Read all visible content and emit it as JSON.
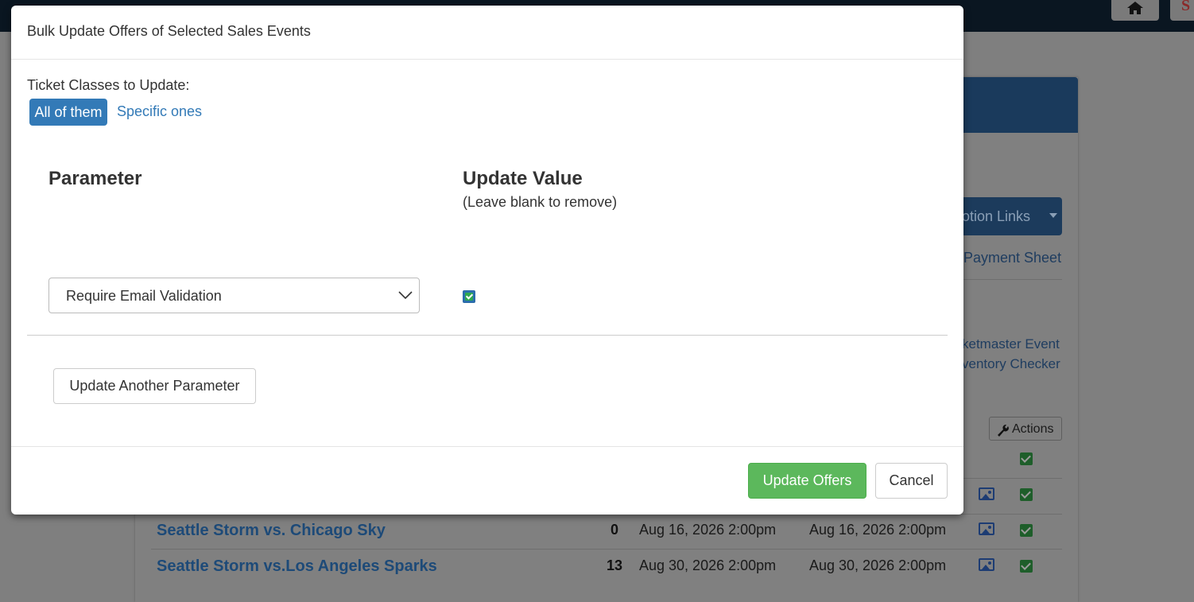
{
  "background": {
    "promotion_links_label": "otion Links",
    "payment_sheet_link": "Payment Sheet",
    "ticketmaster_event_link": "ketmaster Event",
    "inventory_checker_link": "ventory Checker",
    "actions_label": "Actions",
    "events": [
      {
        "title": "Seattle Storm vs. Chicago Sky",
        "count": "0",
        "start": "Aug 16, 2026 2:00pm",
        "end": "Aug 16, 2026 2:00pm"
      },
      {
        "title": "Seattle Storm vs.Los Angeles Sparks",
        "count": "13",
        "start": "Aug 30, 2026 2:00pm",
        "end": "Aug 30, 2026 2:00pm"
      }
    ]
  },
  "modal": {
    "title": "Bulk Update Offers of Selected Sales Events",
    "ticket_classes_label": "Ticket Classes to Update:",
    "options": {
      "all": "All of them",
      "specific": "Specific ones",
      "selected": "all"
    },
    "columns": {
      "parameter": "Parameter",
      "update_value": "Update Value",
      "update_value_hint": "(Leave blank to remove)"
    },
    "parameter_select": {
      "value": "Require Email Validation"
    },
    "value_checked": true,
    "update_another_label": "Update Another Parameter",
    "footer": {
      "update_offers_label": "Update Offers",
      "cancel_label": "Cancel"
    }
  },
  "colors": {
    "primary": "#337ab7",
    "success": "#5cb85c",
    "topbar": "#0a1621"
  }
}
